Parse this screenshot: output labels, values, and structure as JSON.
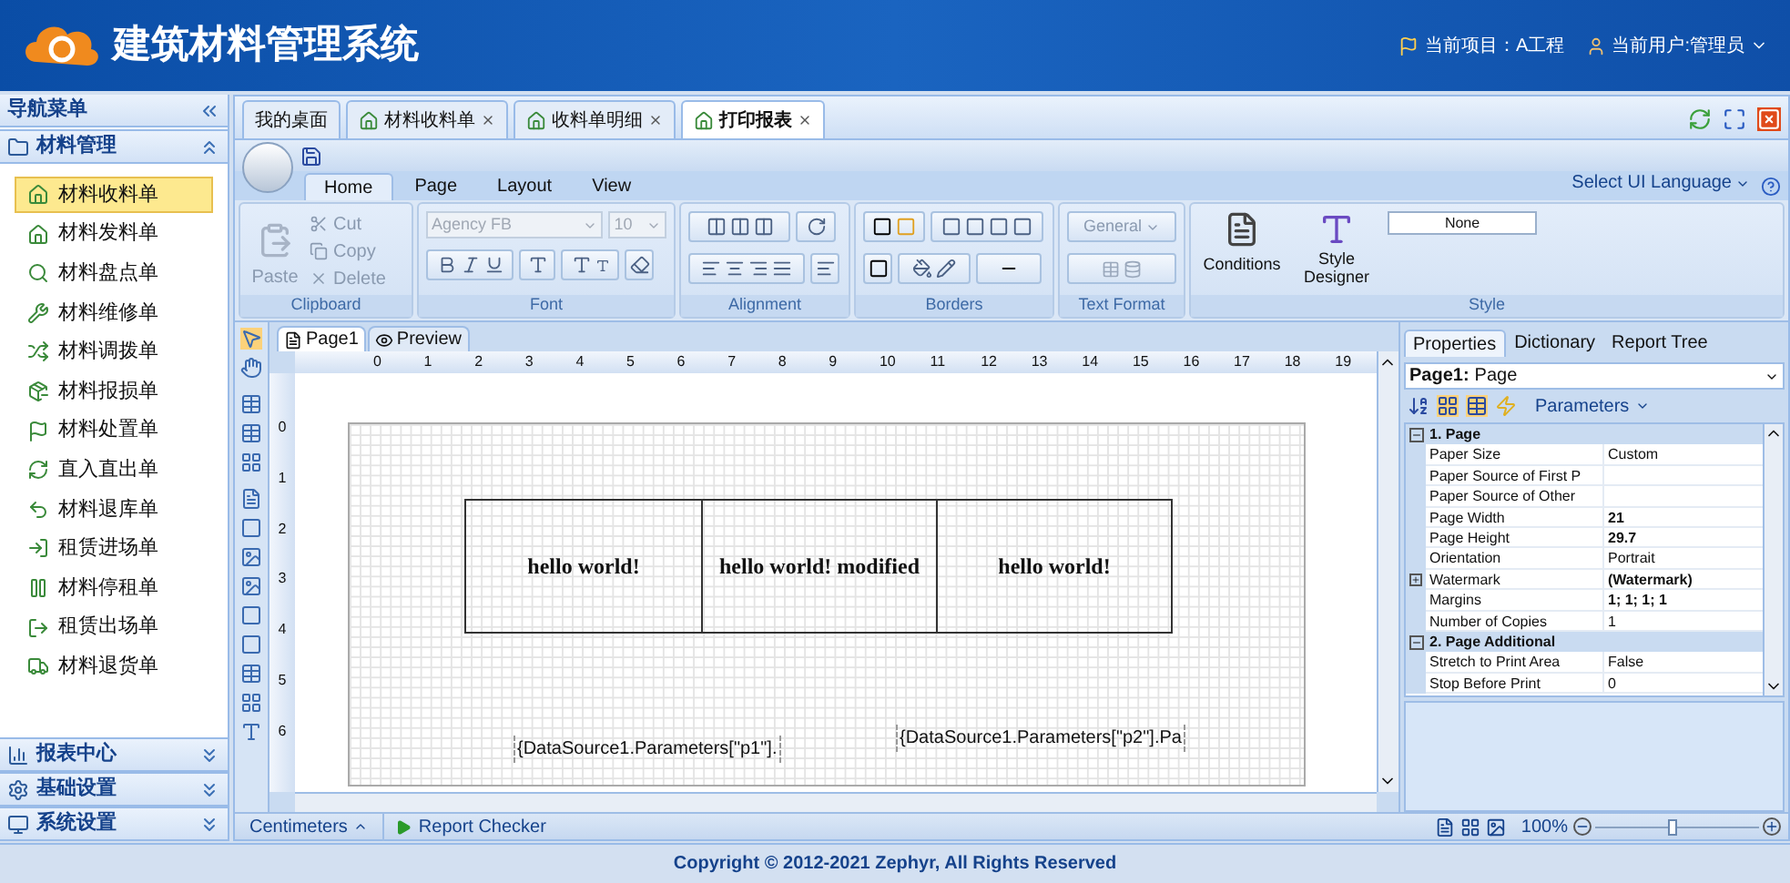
{
  "header": {
    "title": "建筑材料管理系统",
    "project": "当前项目：A工程",
    "user": "当前用户:管理员"
  },
  "sidebar": {
    "title": "导航菜单",
    "groups": [
      {
        "label": "材料管理",
        "expanded": true,
        "items": [
          {
            "label": "材料收料单",
            "selected": true
          },
          {
            "label": "材料发料单",
            "selected": false
          },
          {
            "label": "材料盘点单",
            "selected": false
          },
          {
            "label": "材料维修单",
            "selected": false
          },
          {
            "label": "材料调拨单",
            "selected": false
          },
          {
            "label": "材料报损单",
            "selected": false
          },
          {
            "label": "材料处置单",
            "selected": false
          },
          {
            "label": "直入直出单",
            "selected": false
          },
          {
            "label": "材料退库单",
            "selected": false
          },
          {
            "label": "租赁进场单",
            "selected": false
          },
          {
            "label": "材料停租单",
            "selected": false
          },
          {
            "label": "租赁出场单",
            "selected": false
          },
          {
            "label": "材料退货单",
            "selected": false
          }
        ]
      },
      {
        "label": "报表中心",
        "expanded": false
      },
      {
        "label": "基础设置",
        "expanded": false
      },
      {
        "label": "系统设置",
        "expanded": false
      }
    ]
  },
  "tabs": [
    {
      "label": "我的桌面",
      "selected": false,
      "closable": false
    },
    {
      "label": "材料收料单",
      "selected": false,
      "closable": true
    },
    {
      "label": "收料单明细",
      "selected": false,
      "closable": true
    },
    {
      "label": "打印报表",
      "selected": true,
      "closable": true
    }
  ],
  "ribbon": {
    "tabs": [
      {
        "label": "Home",
        "selected": true
      },
      {
        "label": "Page",
        "selected": false
      },
      {
        "label": "Layout",
        "selected": false
      },
      {
        "label": "View",
        "selected": false
      }
    ],
    "language": "Select UI Language",
    "clipboard": {
      "title": "Clipboard",
      "paste": "Paste",
      "cut": "Cut",
      "copy": "Copy",
      "delete": "Delete"
    },
    "font": {
      "title": "Font",
      "font_name": "Agency FB",
      "font_size": "10"
    },
    "alignment": {
      "title": "Alignment"
    },
    "borders": {
      "title": "Borders"
    },
    "text_format": {
      "title": "Text Format",
      "format": "General"
    },
    "style": {
      "title": "Style",
      "conditions": "Conditions",
      "style_designer": "Style Designer",
      "style_value": "None"
    }
  },
  "designer": {
    "page_tabs": [
      {
        "label": "Page1",
        "selected": true
      },
      {
        "label": "Preview",
        "selected": false
      }
    ],
    "ruler_h": [
      "0",
      "1",
      "2",
      "3",
      "4",
      "5",
      "6",
      "7",
      "8",
      "9",
      "10",
      "11",
      "12",
      "13",
      "14",
      "15",
      "16",
      "17",
      "18",
      "19"
    ],
    "ruler_v": [
      "0",
      "1",
      "2",
      "3",
      "4",
      "5",
      "6"
    ],
    "cells": [
      "hello world!",
      "hello world! modified",
      "hello world!"
    ],
    "fields": [
      "{DataSource1.Parameters[\"p1\"].",
      "{DataSource1.Parameters[\"p2\"].Pa"
    ]
  },
  "properties": {
    "tabs": [
      {
        "label": "Properties",
        "selected": true
      },
      {
        "label": "Dictionary",
        "selected": false
      },
      {
        "label": "Report Tree",
        "selected": false
      }
    ],
    "object_name": "Page1:",
    "object_type": "Page",
    "parameters": "Parameters",
    "categories": [
      {
        "title": "1. Page",
        "expanded": true,
        "props": [
          {
            "name": "Paper Size",
            "value": "Custom",
            "bold": false,
            "kind": "plain"
          },
          {
            "name": "Paper Source of First P",
            "bold": false,
            "kind": "plain"
          },
          {
            "name": "Paper Source of Other",
            "bold": false,
            "kind": "plain"
          },
          {
            "name": "Page Width",
            "value": "21",
            "bold": true,
            "kind": "plain"
          },
          {
            "name": "Page Height",
            "value": "29.7",
            "bold": true,
            "kind": "plain"
          },
          {
            "name": "Orientation",
            "value": "Portrait",
            "bold": false,
            "kind": "plain"
          },
          {
            "name": "Watermark",
            "value": "(Watermark)",
            "bold": true,
            "kind": "expandable"
          },
          {
            "name": "Margins",
            "value": "1; 1; 1; 1",
            "bold": true,
            "kind": "plain"
          },
          {
            "name": "Number of Copies",
            "value": "1",
            "bold": false,
            "kind": "plain"
          }
        ]
      },
      {
        "title": "2. Page Additional",
        "expanded": true,
        "props": [
          {
            "name": "Stretch to Print Area",
            "value": "False",
            "bold": false,
            "kind": "plain"
          },
          {
            "name": "Stop Before Print",
            "value": "0",
            "bold": false,
            "kind": "plain"
          }
        ]
      }
    ]
  },
  "status_bar": {
    "units": "Centimeters",
    "checker": "Report Checker",
    "zoom": "100%",
    "level": 0.48
  },
  "footer": "Copyright © 2012-2021 Zephyr, All Rights Reserved"
}
